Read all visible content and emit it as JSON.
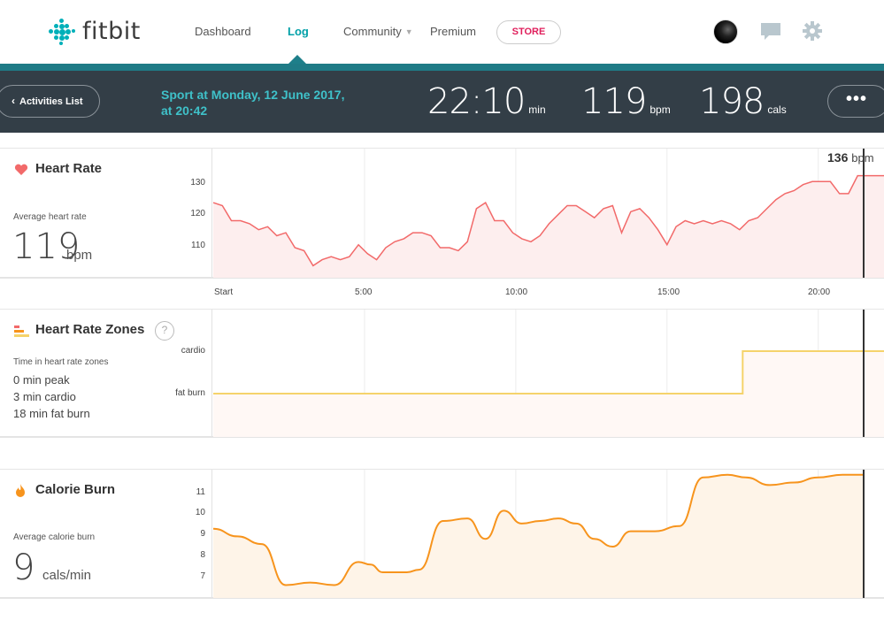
{
  "nav": {
    "logo_text": "fitbit",
    "links": [
      "Dashboard",
      "Log",
      "Community",
      "Premium"
    ],
    "store_label": "STORE",
    "active_link": "Log"
  },
  "header": {
    "back_label": "Activities List",
    "title_line1": "Sport at Monday, 12 June 2017,",
    "title_line2": "at 20:42",
    "duration": "22:10",
    "duration_unit": "min",
    "heart_rate": "119",
    "heart_rate_unit": "bpm",
    "calories": "198",
    "calories_unit": "cals",
    "more_label": "•••"
  },
  "heart_rate": {
    "title": "Heart Rate",
    "avg_label": "Average heart rate",
    "avg_value": "119",
    "avg_unit": "bpm",
    "yticks": [
      "130",
      "120",
      "110"
    ],
    "cursor_value": "136",
    "cursor_unit": "bpm",
    "xticks": [
      "Start",
      "5:00",
      "10:00",
      "15:00",
      "20:00"
    ]
  },
  "zones": {
    "title": "Heart Rate Zones",
    "help": "?",
    "label": "Time in heart rate zones",
    "lines": [
      "0 min peak",
      "3 min cardio",
      "18 min fat burn"
    ],
    "yticks": [
      "cardio",
      "fat burn"
    ]
  },
  "calories": {
    "title": "Calorie Burn",
    "avg_label": "Average calorie burn",
    "avg_value": "9",
    "avg_unit": "cals/min",
    "yticks": [
      "11",
      "10",
      "9",
      "8",
      "7"
    ]
  },
  "colors": {
    "teal": "#00B0B9",
    "heart": "#F26A6A",
    "zone": "#F5D36B",
    "calorie": "#F7941D"
  },
  "chart_data": [
    {
      "type": "line",
      "name": "heart-rate",
      "xlabel": "",
      "ylabel": "",
      "x_unit": "minutes",
      "ylim": [
        102,
        145
      ],
      "x": [
        0,
        0.3,
        0.6,
        0.9,
        1.2,
        1.5,
        1.8,
        2.1,
        2.4,
        2.7,
        3,
        3.3,
        3.6,
        3.9,
        4.2,
        4.5,
        4.8,
        5.1,
        5.4,
        5.7,
        6,
        6.3,
        6.6,
        6.9,
        7.2,
        7.5,
        7.8,
        8.1,
        8.4,
        8.7,
        9,
        9.3,
        9.6,
        9.9,
        10.2,
        10.5,
        10.8,
        11.1,
        11.4,
        11.7,
        12,
        12.3,
        12.6,
        12.9,
        13.2,
        13.5,
        13.8,
        14.1,
        14.4,
        14.7,
        15,
        15.3,
        15.6,
        15.9,
        16.2,
        16.5,
        16.8,
        17.1,
        17.4,
        17.7,
        18,
        18.3,
        18.6,
        18.9,
        19.2,
        19.5,
        19.8,
        20.1,
        20.4,
        20.7,
        21,
        21.3,
        21.5
      ],
      "y": [
        127,
        126,
        121,
        121,
        120,
        118,
        119,
        116,
        117,
        112,
        111,
        106,
        108,
        109,
        108,
        109,
        113,
        110,
        108,
        112,
        114,
        115,
        117,
        117,
        116,
        112,
        112,
        111,
        114,
        125,
        127,
        121,
        121,
        117,
        115,
        114,
        116,
        120,
        123,
        126,
        126,
        124,
        122,
        125,
        126,
        117,
        124,
        125,
        122,
        118,
        113,
        119,
        121,
        120,
        121,
        120,
        121,
        120,
        118,
        121,
        122,
        125,
        128,
        130,
        131,
        133,
        134,
        134,
        134,
        130,
        130,
        136,
        136
      ]
    },
    {
      "type": "line",
      "name": "heart-rate-zones",
      "categories": [
        "fat burn",
        "cardio"
      ],
      "x_unit": "minutes",
      "x": [
        0,
        17.5,
        17.5,
        21.5
      ],
      "zone": [
        "fat burn",
        "fat burn",
        "cardio",
        "cardio"
      ]
    },
    {
      "type": "area",
      "name": "calorie-burn",
      "xlabel": "",
      "ylabel": "",
      "x_unit": "minutes",
      "ylim": [
        6.5,
        11.5
      ],
      "x": [
        0,
        0.8,
        1.6,
        2.4,
        3.2,
        4,
        4.8,
        5.2,
        5.6,
        6,
        6.4,
        6.8,
        7.6,
        8.4,
        9,
        9.6,
        10.2,
        10.8,
        11.4,
        12,
        12.6,
        13.2,
        13.8,
        14.6,
        15.4,
        16.2,
        17,
        17.6,
        18.4,
        19.2,
        20,
        20.8,
        21.5
      ],
      "y": [
        9.2,
        8.9,
        8.6,
        7,
        7.1,
        7,
        7.9,
        7.8,
        7.5,
        7.5,
        7.5,
        7.6,
        9.5,
        9.6,
        8.8,
        9.9,
        9.4,
        9.5,
        9.6,
        9.4,
        8.8,
        8.5,
        9.1,
        9.1,
        9.3,
        11.2,
        11.3,
        11.2,
        10.9,
        11.0,
        11.2,
        11.3,
        11.3
      ]
    }
  ]
}
